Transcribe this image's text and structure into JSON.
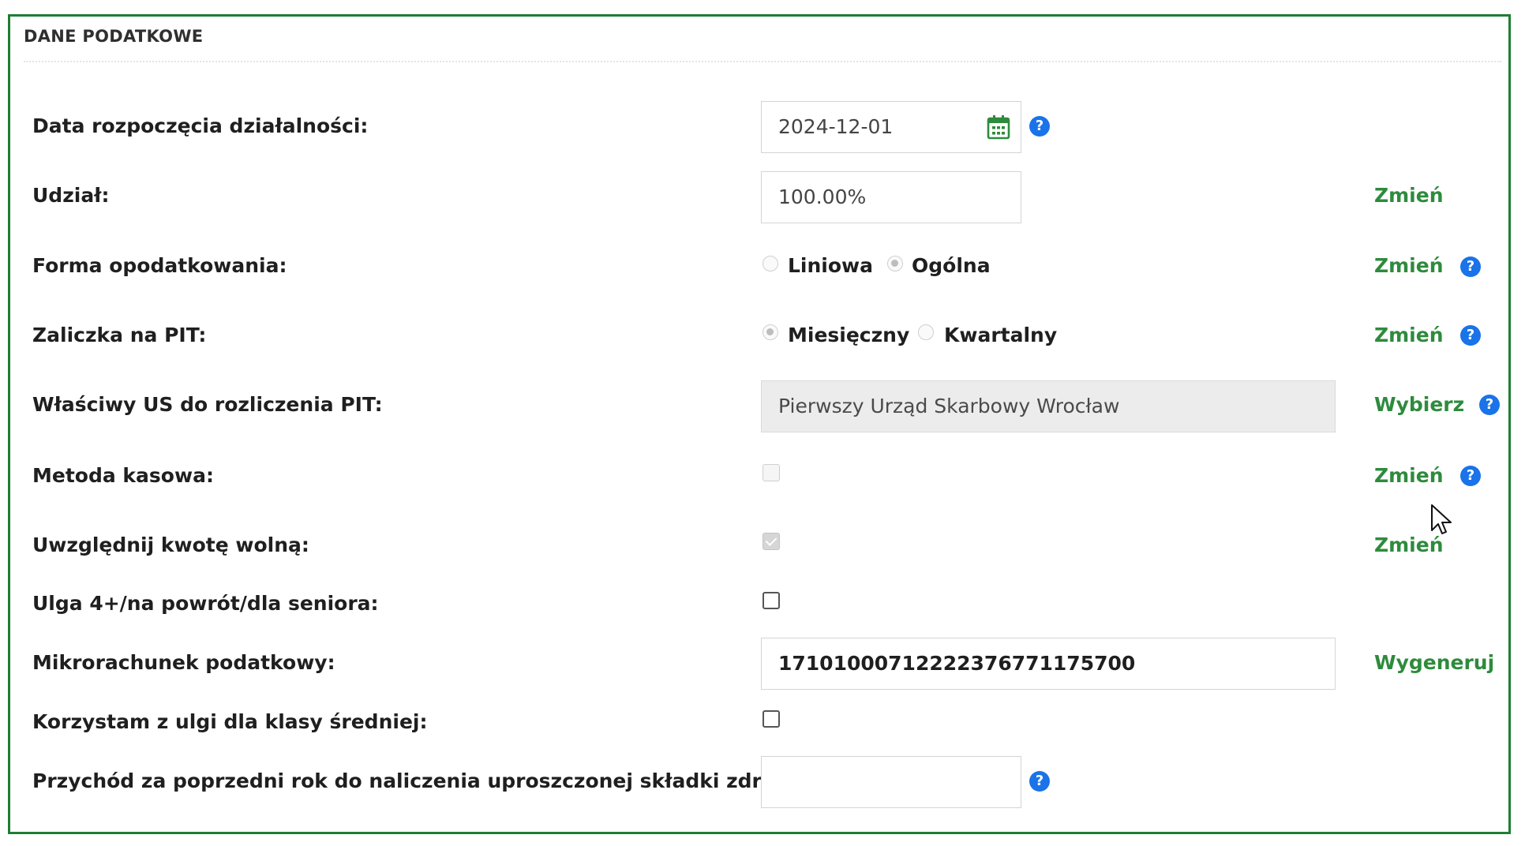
{
  "section": {
    "title": "DANE PODATKOWE"
  },
  "rows": {
    "start_date": {
      "label": "Data rozpoczęcia działalności:",
      "value": "2024-12-01"
    },
    "share": {
      "label": "Udział:",
      "value": "100.00%",
      "action": "Zmień"
    },
    "tax_form": {
      "label": "Forma opodatkowania:",
      "options": [
        "Liniowa",
        "Ogólna"
      ],
      "selected": "Ogólna",
      "action": "Zmień"
    },
    "pit_advance": {
      "label": "Zaliczka na PIT:",
      "options": [
        "Miesięczny",
        "Kwartalny"
      ],
      "selected": "Miesięczny",
      "action": "Zmień"
    },
    "tax_office": {
      "label": "Właściwy US do rozliczenia PIT:",
      "value": "Pierwszy Urząd Skarbowy Wrocław",
      "action": "Wybierz"
    },
    "cash_method": {
      "label": "Metoda kasowa:",
      "checked": false,
      "action": "Zmień"
    },
    "free_amount": {
      "label": "Uwzględnij kwotę wolną:",
      "checked": true,
      "action": "Zmień"
    },
    "relief_4plus": {
      "label": "Ulga 4+/na powrót/dla seniora:",
      "checked": false
    },
    "micro_account": {
      "label": "Mikrorachunek podatkowy:",
      "value": "17101000712222376771175700",
      "action": "Wygeneruj"
    },
    "middle_class": {
      "label": "Korzystam z ulgi dla klasy średniej:",
      "checked": false
    },
    "prev_income": {
      "label": "Przychód za poprzedni rok do naliczenia uproszczonej składki zdrowotnej:",
      "value": ""
    }
  },
  "help_glyph": "?",
  "colors": {
    "border": "#1e7e34",
    "action": "#2e8b3d",
    "help": "#1a73e8",
    "calendar": "#2e8b3d"
  },
  "icons": {
    "calendar": "calendar-icon",
    "help": "help-icon",
    "cursor": "mouse-pointer-icon"
  }
}
